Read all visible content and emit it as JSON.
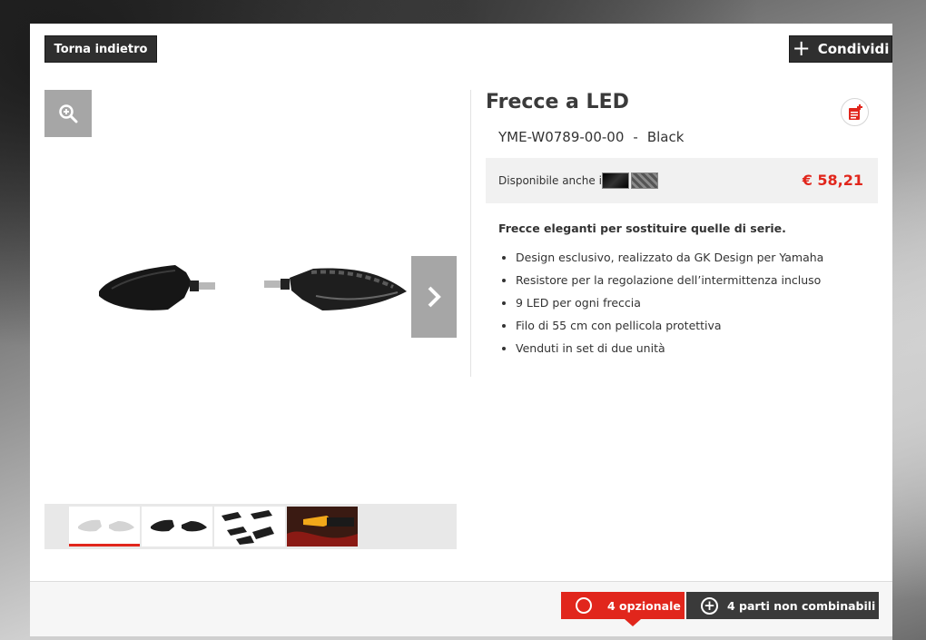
{
  "header": {
    "back_label": "Torna indietro",
    "share_label": "Condividi"
  },
  "gallery": {
    "zoom_icon": "zoom-in-icon",
    "next_icon": "chevron-right-icon",
    "thumbnail_count": 4,
    "active_thumbnail": 1
  },
  "product": {
    "title": "Frecce a LED",
    "sku": "YME-W0789-00-00",
    "separator": "-",
    "color": "Black",
    "availability_label": "Disponibile anche in",
    "price": "€ 58,21",
    "description_intro": "Frecce eleganti per sostituire quelle di serie.",
    "features": [
      "Design esclusivo, realizzato da GK Design per Yamaha",
      "Resistore per la regolazione dell’intermittenza incluso",
      "9 LED per ogni freccia",
      "Filo di 55 cm con pellicola protettiva",
      "Venduti in set di due unità"
    ]
  },
  "footer": {
    "optional_label": "4 opzionale",
    "noncombinable_label": "4 parti non combinabili"
  },
  "colors": {
    "accent": "#e1261c",
    "dark_button": "#2f2f2f",
    "gray_control": "#a6a6a6"
  }
}
